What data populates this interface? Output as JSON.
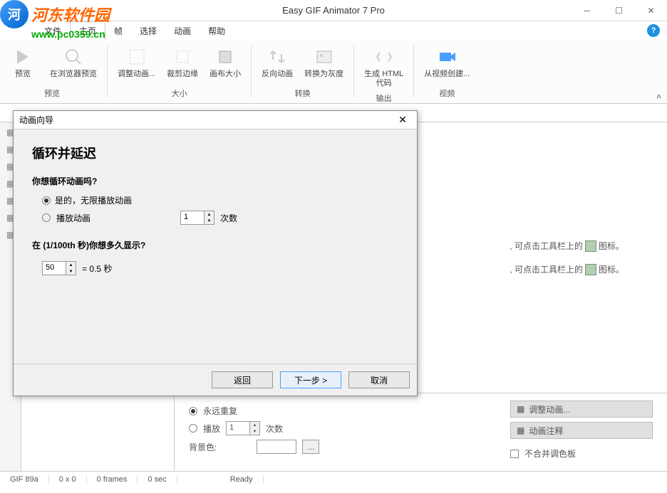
{
  "window": {
    "title": "Easy GIF Animator 7 Pro"
  },
  "watermark": {
    "text": "河东软件园",
    "url": "www.pc0359.cn"
  },
  "menu": {
    "file": "文件",
    "home": "主页",
    "frame": "帧",
    "select": "选择",
    "animation": "动画",
    "help": "帮助"
  },
  "ribbon": {
    "preview": "预览",
    "browser_preview": "在浏览器预览",
    "resize_anim": "调整动画...",
    "crop_edges": "裁剪边缘",
    "canvas_size": "画布大小",
    "reverse_anim": "反向动画",
    "to_grayscale": "转换为灰度",
    "gen_html": "生成 HTML\n代码",
    "from_video": "从视频创建...",
    "group_preview": "预览",
    "group_size": "大小",
    "group_convert": "转换",
    "group_output": "输出",
    "group_video": "视频"
  },
  "dialog": {
    "title": "动画向导",
    "heading": "循环并延迟",
    "q1": "你想循环动画吗?",
    "opt_infinite": "是的，无限播放动画",
    "opt_play": "播放动画",
    "play_count": "1",
    "times": "次数",
    "q2": "在 (1/100th 秒)你想多久显示?",
    "delay_value": "50",
    "delay_label": " = 0.5 秒",
    "btn_back": "返回",
    "btn_next": "下一步 >",
    "btn_cancel": "取消"
  },
  "canvas": {
    "hint1": ", 可点击工具栏上的",
    "hint1_end": "图标。",
    "hint2": ", 可点击工具栏上的",
    "hint2_end": "图标。"
  },
  "props": {
    "repeat_forever": "永远重复",
    "play": "播放",
    "play_count": "1",
    "times": "次数",
    "bg_color": "背景色:",
    "btn_resize": "调整动画...",
    "btn_annotate": "动画注释",
    "chk_no_merge": "不合并调色板"
  },
  "status": {
    "format": "GIF 89a",
    "size": "0 x 0",
    "frames": "0 frames",
    "duration": "0 sec",
    "ready": "Ready"
  }
}
